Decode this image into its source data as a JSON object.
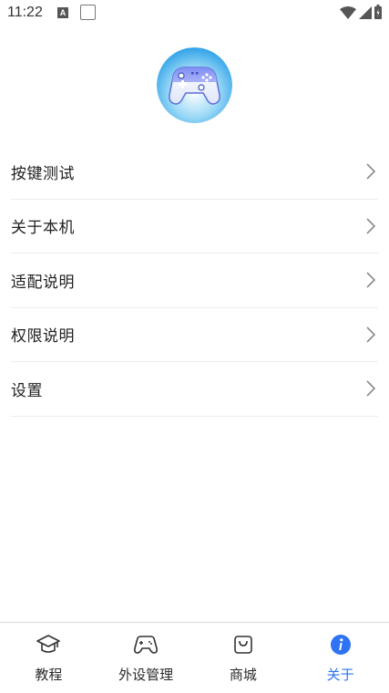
{
  "status_bar": {
    "time": "11:22",
    "a_badge": "A"
  },
  "avatar": {
    "icon": "gamepad-icon"
  },
  "menu": {
    "items": [
      {
        "label": "按键测试"
      },
      {
        "label": "关于本机"
      },
      {
        "label": "适配说明"
      },
      {
        "label": "权限说明"
      },
      {
        "label": "设置"
      }
    ]
  },
  "bottom_nav": {
    "items": [
      {
        "label": "教程",
        "icon": "graduation-cap-icon",
        "active": false
      },
      {
        "label": "外设管理",
        "icon": "gamepad-icon",
        "active": false
      },
      {
        "label": "商城",
        "icon": "shopping-bag-icon",
        "active": false
      },
      {
        "label": "关于",
        "icon": "info-icon",
        "active": true
      }
    ]
  },
  "colors": {
    "accent": "#2f73f4",
    "divider": "#ededed",
    "text": "#1f1f1f"
  }
}
